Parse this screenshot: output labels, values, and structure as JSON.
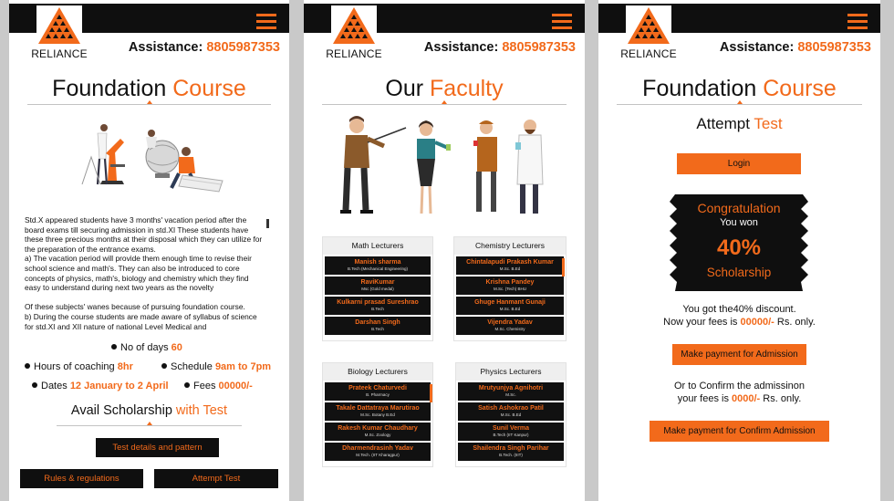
{
  "brand": {
    "name": "RELIANCE",
    "accent": "#f26a1b",
    "dark": "#0f0f0f"
  },
  "assistance": {
    "label": "Assistance:",
    "phone": "8805987353"
  },
  "panel1": {
    "heading_main": "Foundation",
    "heading_accent": "Course",
    "paragraph": "Std.X appeared students have 3 months' vacation period after the board exams till securing admission in std.XI These students have these three precious months at their disposal which they can utilize for the preparation of the entrance exams.\na) The vacation period will provide them enough time to revise their school science and math's. They can also be introduced to core concepts of physics, math's, biology and chemistry which they find easy to understand during next two years as the novelty\n\nOf these subjects' wanes because of pursuing foundation course.\nb) During the course students are made aware of syllabus of science for std.XI and XII nature of national Level Medical and",
    "info": {
      "days_label": "No of days",
      "days_value": "60",
      "hours_label": "Hours of coaching",
      "hours_value": "8hr",
      "schedule_label": "Schedule",
      "schedule_value": "9am to 7pm",
      "dates_label": "Dates",
      "dates_value": "12 January to 2 April",
      "fees_label": "Fees",
      "fees_value": "00000/-"
    },
    "scholarship_main": "Avail Scholarship",
    "scholarship_accent": "with Test",
    "buttons": {
      "test_details": "Test details and pattern",
      "rules": "Rules & regulations",
      "attempt": "Attempt Test"
    }
  },
  "panel2": {
    "heading_main": "Our",
    "heading_accent": "Faculty",
    "groups": [
      {
        "title": "Math Lecturers",
        "items": [
          {
            "name": "Manish  sharma",
            "degree": "B.Tech (Mechanical Engineering)"
          },
          {
            "name": "RaviKumar",
            "degree": "Msc (Gold medal)"
          },
          {
            "name": "Kulkarni prasad  Sureshrao",
            "degree": "B.Tech"
          },
          {
            "name": "Darshan Singh",
            "degree": "B.Tech"
          }
        ]
      },
      {
        "title": "Chemistry Lecturers",
        "items": [
          {
            "name": "Chintalapudi Prakash Kumar",
            "degree": "M.Sc. B.Ed"
          },
          {
            "name": "Krishna Pandey",
            "degree": "M.Sc. (Tech) BHU"
          },
          {
            "name": "Ghuge Hanmant Gunaji",
            "degree": "M.Sc. B.Ed"
          },
          {
            "name": "Vijendra Yadav",
            "degree": "M.Sc. Chemistry"
          }
        ]
      },
      {
        "title": "Biology Lecturers",
        "items": [
          {
            "name": "Prateek Chaturvedi",
            "degree": "B. Pharmacy"
          },
          {
            "name": "Takale Dattatraya Marutirao",
            "degree": "M.Sc. Botany B.Ed"
          },
          {
            "name": "Rakesh Kumar Chaudhary",
            "degree": "M.Sc. Zoology"
          },
          {
            "name": "Dharmendrasinh Yadav",
            "degree": "M.Tech. (IIT Kharagpur)"
          }
        ]
      },
      {
        "title": "Physics Lecturers",
        "items": [
          {
            "name": "Mrutyunjya Agnihotri",
            "degree": "M.Sc."
          },
          {
            "name": "Satish Ashokrao Patil",
            "degree": "M.Sc. B.Ed"
          },
          {
            "name": "Sunil Verma",
            "degree": "B.Tech (IIT Kanpur)"
          },
          {
            "name": "Shailendra Singh Parihar",
            "degree": "B.Tech. (IIIT)"
          }
        ]
      }
    ]
  },
  "panel3": {
    "heading_main": "Foundation",
    "heading_accent": "Course",
    "attempt_main": "Attempt",
    "attempt_accent": "Test",
    "login": "Login",
    "banner": {
      "line1": "Congratulation",
      "line2": "You won",
      "line3": "40%",
      "line4": "Scholarship"
    },
    "discount_line1": "You got the40% discount.",
    "discount_line2_pre": "Now your fees is",
    "discount_line2_val": "00000/-",
    "discount_line2_post": "Rs. only.",
    "pay_admission": "Make payment for Admission",
    "confirm_line1": "Or to Confirm the admissinon",
    "confirm_line2_pre": "your fees is",
    "confirm_line2_val": "0000/-",
    "confirm_line2_post": "Rs. only.",
    "pay_confirm": "Make payment for Confirm Admission"
  }
}
